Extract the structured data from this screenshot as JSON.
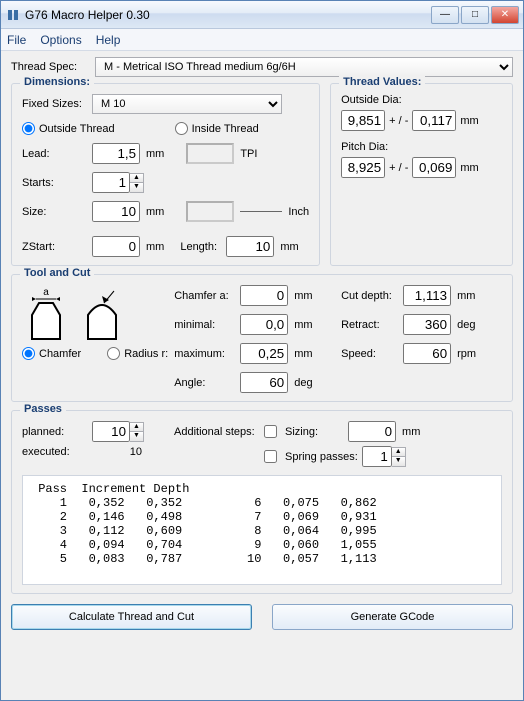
{
  "window": {
    "title": "G76 Macro Helper 0.30"
  },
  "menu": {
    "file": "File",
    "options": "Options",
    "help": "Help"
  },
  "threadspec": {
    "label": "Thread Spec:",
    "value": "M - Metrical ISO Thread medium 6g/6H"
  },
  "dimensions": {
    "legend": "Dimensions:",
    "fixed_label": "Fixed Sizes:",
    "fixed_value": "M 10",
    "outside_label": "Outside Thread",
    "inside_label": "Inside Thread",
    "lead": {
      "label": "Lead:",
      "value": "1,5",
      "unit": "mm",
      "tpi_label": "TPI",
      "tpi_value": ""
    },
    "starts": {
      "label": "Starts:",
      "value": "1"
    },
    "size": {
      "label": "Size:",
      "value": "10",
      "unit": "mm",
      "inch_label": "Inch",
      "inch_value": ""
    },
    "zstart": {
      "label": "ZStart:",
      "value": "0",
      "unit": "mm"
    },
    "length": {
      "label": "Length:",
      "value": "10",
      "unit": "mm"
    }
  },
  "thread_values": {
    "legend": "Thread Values:",
    "outside_dia": {
      "label": "Outside Dia:",
      "value": "9,851",
      "tol": "0,117",
      "unit": "mm",
      "pm": "+ / -"
    },
    "pitch_dia": {
      "label": "Pitch Dia:",
      "value": "8,925",
      "tol": "0,069",
      "unit": "mm",
      "pm": "+ / -"
    }
  },
  "tool": {
    "legend": "Tool and Cut",
    "chamfer_dim": "a",
    "chamfer_radio": "Chamfer",
    "radius_radio": "Radius r:",
    "chamfer_a": {
      "label": "Chamfer a:",
      "value": "0",
      "unit": "mm"
    },
    "minimal": {
      "label": "minimal:",
      "value": "0,0",
      "unit": "mm"
    },
    "maximum": {
      "label": "maximum:",
      "value": "0,25",
      "unit": "mm"
    },
    "angle": {
      "label": "Angle:",
      "value": "60",
      "unit": "deg"
    },
    "cut_depth": {
      "label": "Cut depth:",
      "value": "1,113",
      "unit": "mm"
    },
    "retract": {
      "label": "Retract:",
      "value": "360",
      "unit": "deg"
    },
    "speed": {
      "label": "Speed:",
      "value": "60",
      "unit": "rpm"
    }
  },
  "passes": {
    "legend": "Passes",
    "planned": {
      "label": "planned:",
      "value": "10"
    },
    "executed": {
      "label": "executed:",
      "value": "10"
    },
    "add_steps": "Additional steps:",
    "sizing": {
      "label": "Sizing:",
      "value": "0",
      "unit": "mm",
      "checked": false
    },
    "spring": {
      "label": "Spring passes:",
      "value": "1",
      "checked": false
    },
    "table": {
      "headers": [
        "Pass",
        "Increment",
        "Depth"
      ],
      "rows": [
        {
          "pass": 1,
          "inc": "0,352",
          "depth": "0,352"
        },
        {
          "pass": 2,
          "inc": "0,146",
          "depth": "0,498"
        },
        {
          "pass": 3,
          "inc": "0,112",
          "depth": "0,609"
        },
        {
          "pass": 4,
          "inc": "0,094",
          "depth": "0,704"
        },
        {
          "pass": 5,
          "inc": "0,083",
          "depth": "0,787"
        },
        {
          "pass": 6,
          "inc": "0,075",
          "depth": "0,862"
        },
        {
          "pass": 7,
          "inc": "0,069",
          "depth": "0,931"
        },
        {
          "pass": 8,
          "inc": "0,064",
          "depth": "0,995"
        },
        {
          "pass": 9,
          "inc": "0,060",
          "depth": "1,055"
        },
        {
          "pass": 10,
          "inc": "0,057",
          "depth": "1,113"
        }
      ]
    }
  },
  "buttons": {
    "calc": "Calculate Thread and Cut",
    "gcode": "Generate GCode"
  }
}
